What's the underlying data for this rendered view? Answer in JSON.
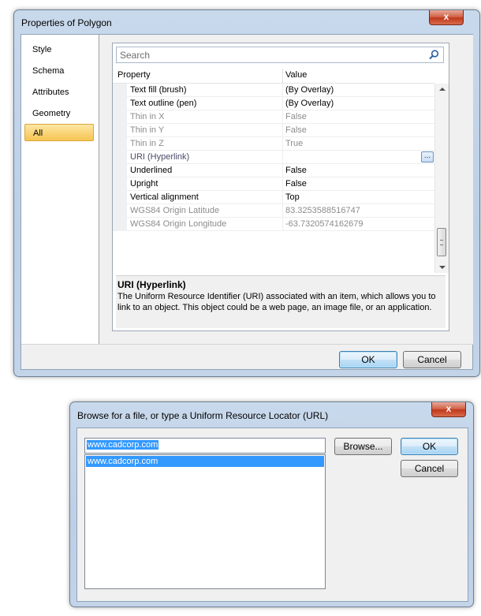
{
  "dialog1": {
    "title": "Properties of Polygon",
    "close_symbol": "x",
    "nav": [
      "Style",
      "Schema",
      "Attributes",
      "Geometry",
      "All"
    ],
    "selected_nav": "All",
    "search_placeholder": "Search",
    "columns": [
      "Property",
      "Value"
    ],
    "rows": [
      {
        "property": "Text fill (brush)",
        "value": "(By Overlay)",
        "disabled": false
      },
      {
        "property": "Text outline (pen)",
        "value": "(By Overlay)",
        "disabled": false
      },
      {
        "property": "Thin in X",
        "value": "False",
        "disabled": true
      },
      {
        "property": "Thin in Y",
        "value": "False",
        "disabled": true
      },
      {
        "property": "Thin in Z",
        "value": "True",
        "disabled": true
      },
      {
        "property": "URI (Hyperlink)",
        "value": "",
        "disabled": false,
        "link": true,
        "button": "..."
      },
      {
        "property": "Underlined",
        "value": "False",
        "disabled": false
      },
      {
        "property": "Upright",
        "value": "False",
        "disabled": false
      },
      {
        "property": "Vertical alignment",
        "value": "Top",
        "disabled": false
      },
      {
        "property": "WGS84 Origin Latitude",
        "value": "83.3253588516747",
        "disabled": true
      },
      {
        "property": "WGS84 Origin Longitude",
        "value": "-63.7320574162679",
        "disabled": true
      }
    ],
    "description": {
      "title": "URI (Hyperlink)",
      "text": "The Uniform Resource Identifier (URI) associated with an item, which allows you to link to an object. This object could be a web page, an image file, or an application."
    },
    "ok_label": "OK",
    "cancel_label": "Cancel"
  },
  "dialog2": {
    "title": "Browse for a file, or type a Uniform Resource Locator (URL)",
    "close_symbol": "x",
    "url_value": "www.cadcorp.com",
    "list_items": [
      "www.cadcorp.com"
    ],
    "browse_label": "Browse...",
    "ok_label": "OK",
    "cancel_label": "Cancel"
  }
}
